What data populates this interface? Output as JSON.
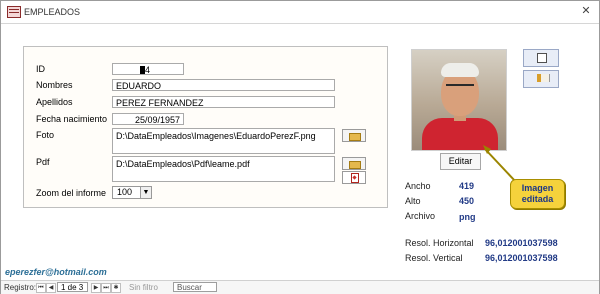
{
  "window": {
    "title": "EMPLEADOS",
    "close_glyph": "✕"
  },
  "form": {
    "id_label": "ID",
    "id_value": "4",
    "nombres_label": "Nombres",
    "nombres_value": "EDUARDO",
    "apellidos_label": "Apellidos",
    "apellidos_value": "PEREZ FERNANDEZ",
    "fecha_label": "Fecha nacimiento",
    "fecha_value": "25/09/1957",
    "foto_label": "Foto",
    "foto_value": "D:\\DataEmpleados\\Imagenes\\EduardoPerezF.png",
    "pdf_label": "Pdf",
    "pdf_value": "D:\\DataEmpleados\\Pdf\\leame.pdf",
    "zoom_label": "Zoom del informe",
    "zoom_value": "100"
  },
  "photo_panel": {
    "edit_label": "Editar",
    "ancho_label": "Ancho",
    "ancho_value": "419",
    "alto_label": "Alto",
    "alto_value": "450",
    "archivo_label": "Archivo",
    "archivo_value": "png",
    "resol_h_label": "Resol. Horizontal",
    "resol_h_value": "96,012001037598",
    "resol_v_label": "Resol. Vertical",
    "resol_v_value": "96,012001037598",
    "note_line1": "Imagen",
    "note_line2": "editada"
  },
  "footer": {
    "email": "eperezfer@hotmail.com",
    "registro_label": "Registro:",
    "record_position": "1 de 3",
    "filter_text": "Sin filtro",
    "search_placeholder": "Buscar"
  },
  "icons": {
    "print": "print-icon",
    "exit": "exit-icon",
    "folder": "folder-icon",
    "pdf": "pdf-icon"
  }
}
